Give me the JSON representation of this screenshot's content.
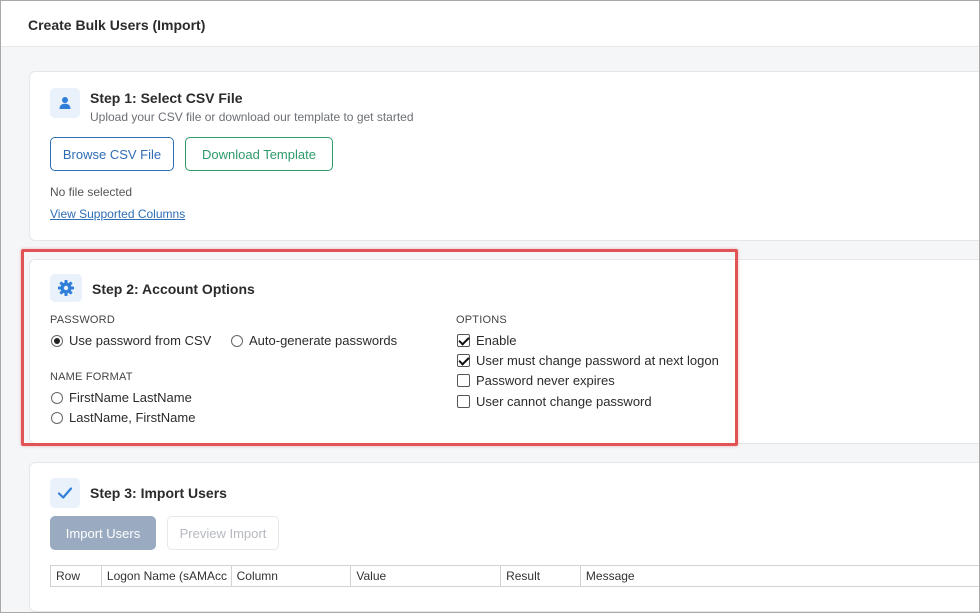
{
  "window": {
    "title": "Create Bulk Users (Import)"
  },
  "step1": {
    "title": "Step 1: Select CSV File",
    "subtitle": "Upload your CSV file or download our template to get started",
    "icon": "user-icon",
    "browse_label": "Browse CSV File",
    "template_label": "Download Template",
    "file_status": "No file selected",
    "columns_link": "View Supported Columns"
  },
  "step2": {
    "title": "Step 2: Account Options",
    "icon": "gear-icon",
    "password": {
      "label": "PASSWORD",
      "options": [
        {
          "label": "Use password from CSV",
          "selected": true
        },
        {
          "label": "Auto-generate passwords",
          "selected": false
        }
      ]
    },
    "name_format": {
      "label": "NAME FORMAT",
      "options": [
        {
          "label": "FirstName LastName",
          "selected": true
        },
        {
          "label": "LastName, FirstName",
          "selected": false
        }
      ]
    },
    "options": {
      "label": "OPTIONS",
      "items": [
        {
          "label": "Enable",
          "checked": true
        },
        {
          "label": "User must change password at next logon",
          "checked": true
        },
        {
          "label": "Password never expires",
          "checked": false
        },
        {
          "label": "User cannot change password",
          "checked": false
        }
      ]
    }
  },
  "step3": {
    "title": "Step 3: Import Users",
    "icon": "checkmark-icon",
    "import_label": "Import Users",
    "preview_label": "Preview Import",
    "columns": [
      "Row",
      "Logon Name (sAMAcc",
      "Column",
      "Value",
      "Result",
      "Message"
    ]
  },
  "colors": {
    "accent_blue": "#2f6db5",
    "accent_green": "#2e9a6a",
    "highlight_red": "#e05456",
    "disabled_button": "#9aaac0"
  }
}
